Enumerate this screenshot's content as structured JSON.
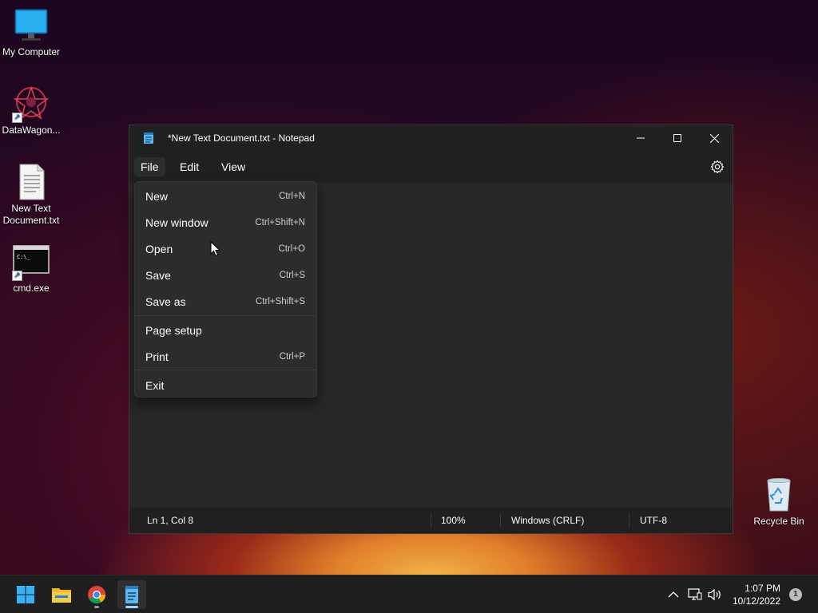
{
  "desktop": {
    "icons": [
      {
        "label": "My Computer"
      },
      {
        "label": "DataWagon..."
      },
      {
        "label": "New Text\nDocument.txt"
      },
      {
        "label": "cmd.exe"
      },
      {
        "label": "Recycle Bin"
      }
    ]
  },
  "window": {
    "title": "*New Text Document.txt - Notepad",
    "app_icon": "notepad-icon",
    "controls": {
      "minimize": "minimize-icon",
      "maximize": "maximize-icon",
      "close": "close-icon"
    }
  },
  "menubar": {
    "items": [
      {
        "label": "File",
        "active": true
      },
      {
        "label": "Edit"
      },
      {
        "label": "View"
      }
    ],
    "settings_icon": "gear-icon"
  },
  "file_menu": {
    "items": [
      {
        "label": "New",
        "shortcut": "Ctrl+N"
      },
      {
        "label": "New window",
        "shortcut": "Ctrl+Shift+N"
      },
      {
        "label": "Open",
        "shortcut": "Ctrl+O"
      },
      {
        "label": "Save",
        "shortcut": "Ctrl+S"
      },
      {
        "label": "Save as",
        "shortcut": "Ctrl+Shift+S"
      },
      {
        "label": "Page setup",
        "shortcut": ""
      },
      {
        "label": "Print",
        "shortcut": "Ctrl+P"
      },
      {
        "label": "Exit",
        "shortcut": ""
      }
    ]
  },
  "statusbar": {
    "position": "Ln 1, Col 8",
    "zoom": "100%",
    "line_ending": "Windows (CRLF)",
    "encoding": "UTF-8"
  },
  "taskbar": {
    "apps": [
      "start-icon",
      "file-explorer-icon",
      "chrome-icon",
      "notepad-icon"
    ],
    "active_app": "notepad-icon"
  },
  "tray": {
    "time": "1:07 PM",
    "date": "10/12/2022",
    "notifications": "1"
  },
  "colors": {
    "window_bg": "#272727",
    "titlebar_bg": "#202020",
    "menu_bg": "#2c2c2c",
    "taskbar_bg": "#1f1f1f",
    "accent": "#4cc2ff"
  }
}
